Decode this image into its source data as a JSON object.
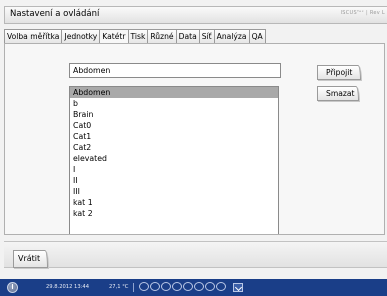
{
  "window": {
    "title": "Nastavení a ovládání",
    "brand": "ISCUSᵀᵉˣ | Rev L"
  },
  "tabs": [
    {
      "label": "Volba měřítka",
      "active": false
    },
    {
      "label": "Jednotky",
      "active": false
    },
    {
      "label": "Katétr",
      "active": true
    },
    {
      "label": "Tisk",
      "active": false
    },
    {
      "label": "Různé",
      "active": false
    },
    {
      "label": "Data",
      "active": false
    },
    {
      "label": "Síť",
      "active": false
    },
    {
      "label": "Analýza",
      "active": false
    },
    {
      "label": "QA",
      "active": false
    }
  ],
  "catheter": {
    "name_value": "Abdomen",
    "items": [
      "Abdomen",
      "b",
      "Brain",
      "Cat0",
      "Cat1",
      "Cat2",
      "elevated",
      "I",
      "II",
      "III",
      "kat 1",
      "kat 2"
    ],
    "selected": "Abdomen",
    "add_label": "Připojit",
    "delete_label": "Smazat"
  },
  "footer": {
    "back_label": "Vrátit"
  },
  "status": {
    "datetime": "29.8.2012 13:44",
    "temperature": "27,1 °C",
    "vial_slots": 8
  },
  "colors": {
    "status_bar": "#1a3e88",
    "selection": "#a9a9a9",
    "panel": "#f7f7f7"
  }
}
